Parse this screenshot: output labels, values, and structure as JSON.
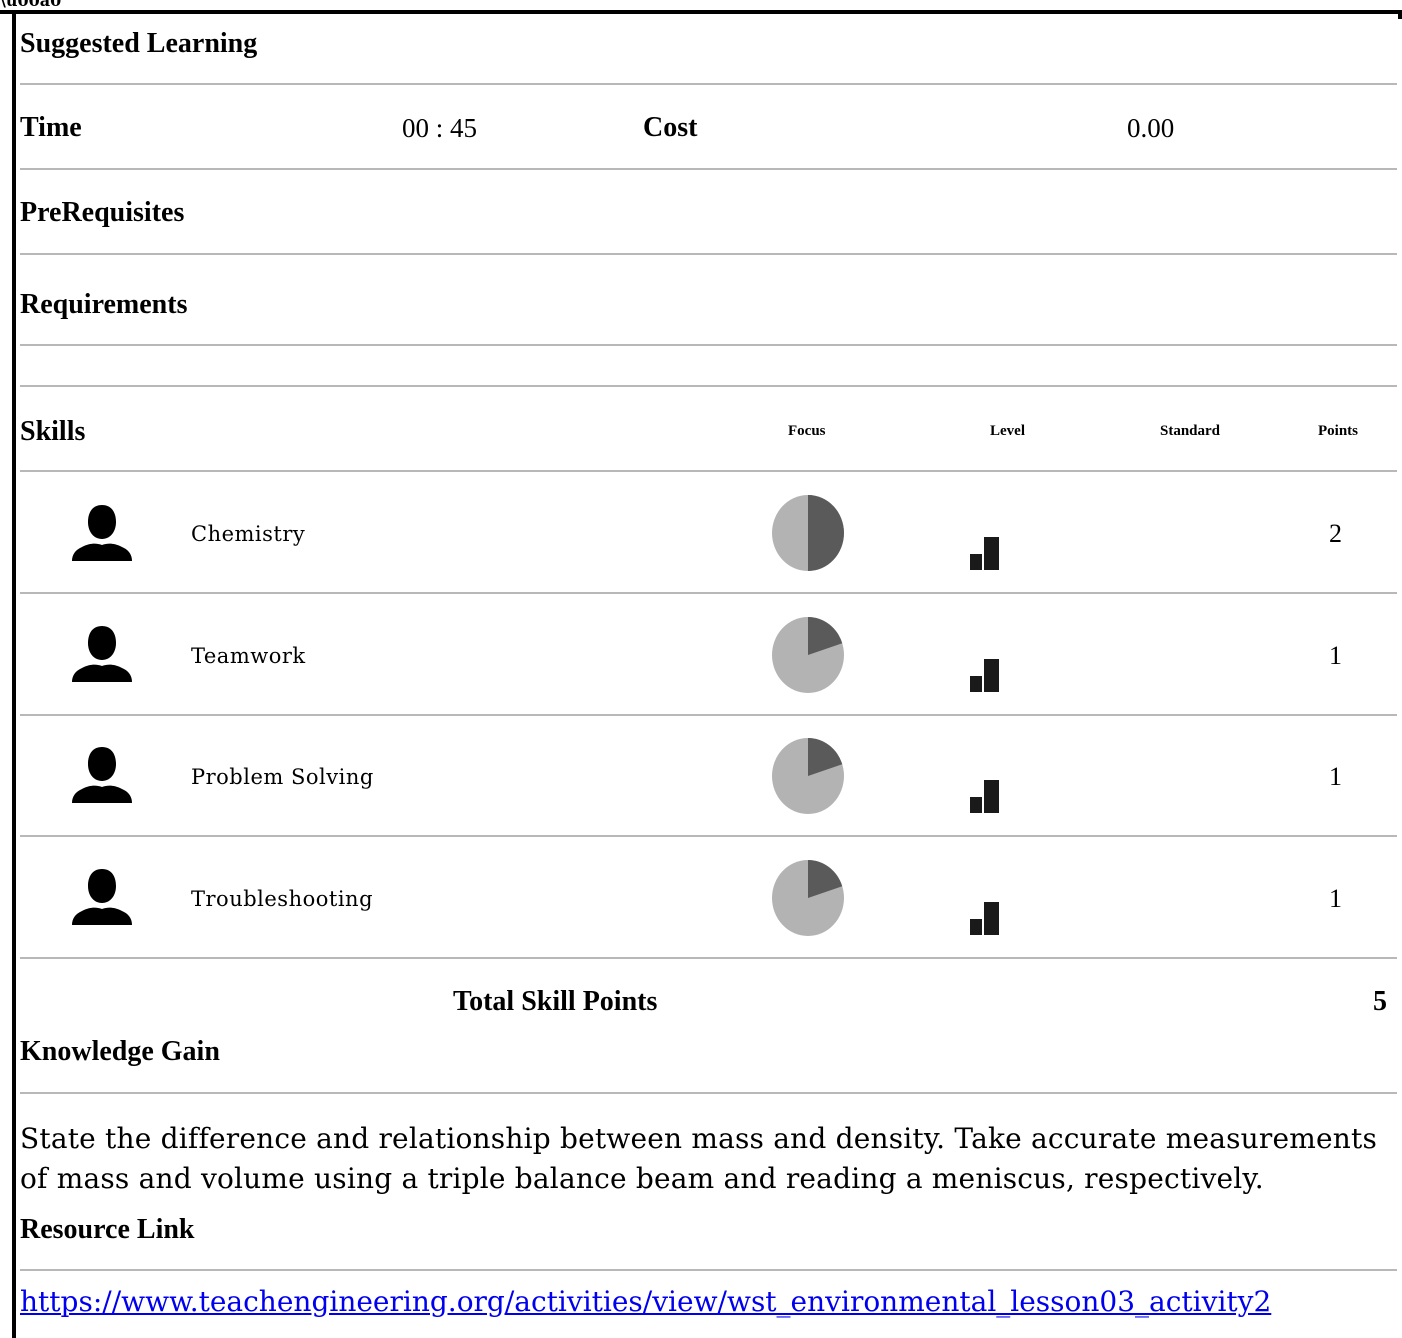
{
  "sections": {
    "suggested_learning": "Suggested Learning",
    "time_label": "Time",
    "time_value": "00 : 45",
    "cost_label": "Cost",
    "cost_value": "0.00",
    "prerequisites": "PreRequisites",
    "requirements": "Requirements",
    "skills": "Skills",
    "knowledge_gain": "Knowledge Gain",
    "resource_link": "Resource Link"
  },
  "skills_table": {
    "columns": [
      "Focus",
      "Level",
      "Standard",
      "Points"
    ],
    "rows": [
      {
        "name": "Chemistry",
        "focus_fraction": 0.5,
        "points": "2"
      },
      {
        "name": "Teamwork",
        "focus_fraction": 0.2,
        "points": "1"
      },
      {
        "name": "Problem Solving",
        "focus_fraction": 0.2,
        "points": "1"
      },
      {
        "name": "Troubleshooting",
        "focus_fraction": 0.2,
        "points": "1"
      }
    ],
    "total_label": "Total Skill Points",
    "total_value": "5"
  },
  "knowledge_text": "State the difference and relationship between mass and density. Take accurate measurements of mass and volume using a triple balance beam and reading a meniscus, respectively.",
  "resource_url": "https://www.teachengineering.org/activities/view/wst_environmental_lesson03_activity2",
  "colors": {
    "pie_dark": "#5a5a5a",
    "pie_light": "#b3b3b3",
    "divider": "#b8b8b8",
    "link": "#0000ee"
  },
  "icons": {
    "user": "user-silhouette-icon",
    "level": "level-bars-icon"
  }
}
